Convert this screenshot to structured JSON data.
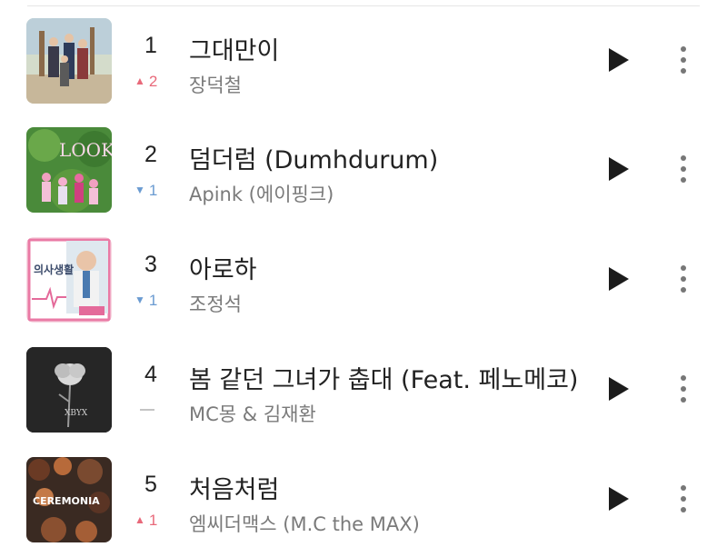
{
  "songs": [
    {
      "rank": "1",
      "change_dir": "up",
      "change_val": "2",
      "title": "그대만이",
      "artist": "장덕철",
      "art": {
        "bg": "#c9d3c2",
        "accent": "#7b5d4a"
      }
    },
    {
      "rank": "2",
      "change_dir": "down",
      "change_val": "1",
      "title": "덤더럼 (Dumhdurum)",
      "artist": "Apink (에이핑크)",
      "art": {
        "bg": "#4f8a3c",
        "accent": "#e86aa0",
        "label": "LOOK"
      }
    },
    {
      "rank": "3",
      "change_dir": "down",
      "change_val": "1",
      "title": "아로하",
      "artist": "조정석",
      "art": {
        "bg": "#f6d6df",
        "accent": "#e46a9a",
        "label": "의사생활"
      }
    },
    {
      "rank": "4",
      "change_dir": "same",
      "change_val": "",
      "title": "봄 같던 그녀가 춥대 (Feat. 페노메코)",
      "artist": "MC몽 & 김재환",
      "art": {
        "bg": "#1f1f1f",
        "accent": "#d9d9d9",
        "label": "XBYX"
      }
    },
    {
      "rank": "5",
      "change_dir": "up",
      "change_val": "1",
      "title": "처음처럼",
      "artist": "엠씨더맥스 (M.C the MAX)",
      "art": {
        "bg": "#3a2a22",
        "accent": "#b76a3a",
        "label": "CEREMONIA"
      }
    }
  ],
  "icons": {
    "play": "play-icon",
    "more": "more-vertical-icon",
    "up": "triangle-up-icon",
    "down": "triangle-down-icon"
  },
  "colors": {
    "up": "#e8697a",
    "down": "#6a9bd1",
    "same": "#c4c4c4"
  }
}
